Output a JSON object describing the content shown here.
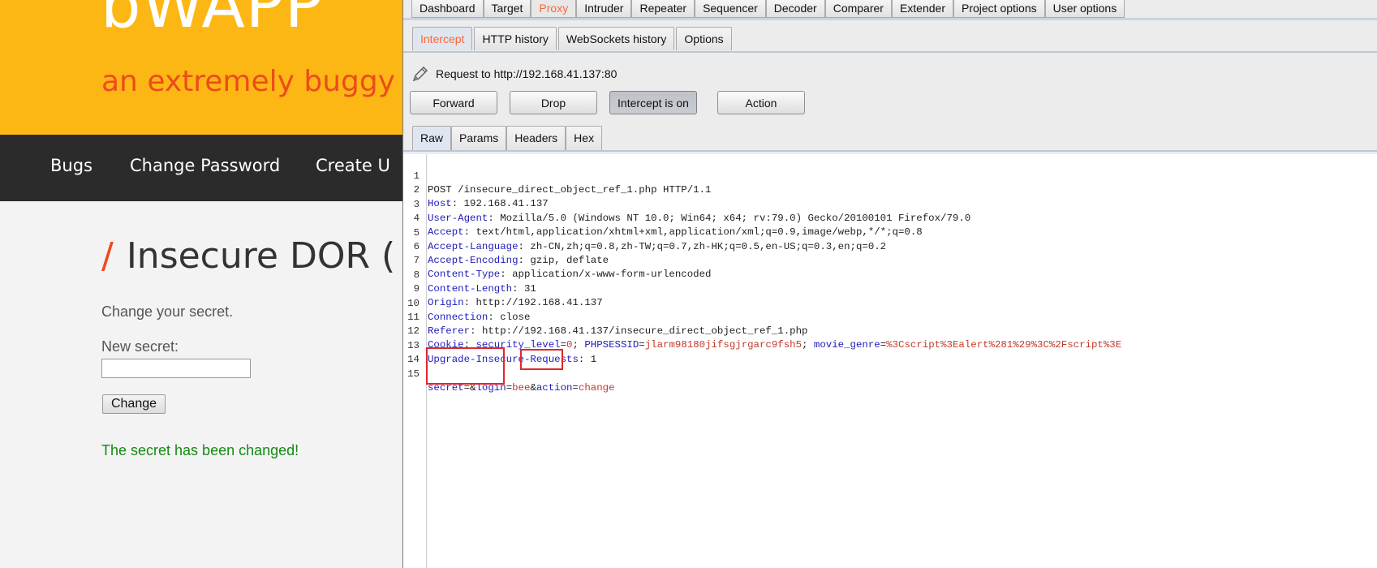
{
  "bwapp": {
    "logo": "bWAPP",
    "tagline": "an extremely buggy",
    "nav": [
      "Bugs",
      "Change Password",
      "Create U"
    ],
    "title_slash": "/",
    "title": "Insecure DOR (",
    "subtitle": "Change your secret.",
    "secret_label": "New secret:",
    "secret_value": "",
    "button": "Change",
    "status": "The secret has been changed!"
  },
  "burp": {
    "main_tabs": [
      "Dashboard",
      "Target",
      "Proxy",
      "Intruder",
      "Repeater",
      "Sequencer",
      "Decoder",
      "Comparer",
      "Extender",
      "Project options",
      "User options"
    ],
    "proxy_tabs": [
      "Intercept",
      "HTTP history",
      "WebSockets history",
      "Options"
    ],
    "request_label": "Request to http://192.168.41.137:80",
    "buttons": {
      "forward": "Forward",
      "drop": "Drop",
      "intercept": "Intercept is on",
      "action": "Action"
    },
    "view_tabs": [
      "Raw",
      "Params",
      "Headers",
      "Hex"
    ],
    "request_line": "POST /insecure_direct_object_ref_1.php HTTP/1.1",
    "headers": [
      {
        "name": "Host",
        "value": "192.168.41.137"
      },
      {
        "name": "User-Agent",
        "value": "Mozilla/5.0 (Windows NT 10.0; Win64; x64; rv:79.0) Gecko/20100101 Firefox/79.0"
      },
      {
        "name": "Accept",
        "value": "text/html,application/xhtml+xml,application/xml;q=0.9,image/webp,*/*;q=0.8"
      },
      {
        "name": "Accept-Language",
        "value": "zh-CN,zh;q=0.8,zh-TW;q=0.7,zh-HK;q=0.5,en-US;q=0.3,en;q=0.2"
      },
      {
        "name": "Accept-Encoding",
        "value": "gzip, deflate"
      },
      {
        "name": "Content-Type",
        "value": "application/x-www-form-urlencoded"
      },
      {
        "name": "Content-Length",
        "value": "31"
      },
      {
        "name": "Origin",
        "value": "http://192.168.41.137"
      },
      {
        "name": "Connection",
        "value": "close"
      },
      {
        "name": "Referer",
        "value": "http://192.168.41.137/insecure_direct_object_ref_1.php"
      }
    ],
    "cookie": {
      "name": "Cookie",
      "pairs": [
        {
          "k": "security_level",
          "v": "0"
        },
        {
          "k": "PHPSESSID",
          "v": "jlarm98180jifsgjrgarc9fsh5"
        },
        {
          "k": "movie_genre",
          "v": "%3Cscript%3Ealert%281%29%3C%2Fscript%3E"
        }
      ]
    },
    "upgrade": {
      "name": "Upgrade-Insecure-Requests",
      "value": "1"
    },
    "body_params": [
      {
        "k": "secret",
        "v": ""
      },
      {
        "k": "login",
        "v": "bee"
      },
      {
        "k": "action",
        "v": "change"
      }
    ],
    "line_numbers": [
      "1",
      "2",
      "3",
      "4",
      "5",
      "6",
      "7",
      "8",
      "9",
      "10",
      "11",
      "12",
      "13",
      "14",
      "15"
    ]
  }
}
